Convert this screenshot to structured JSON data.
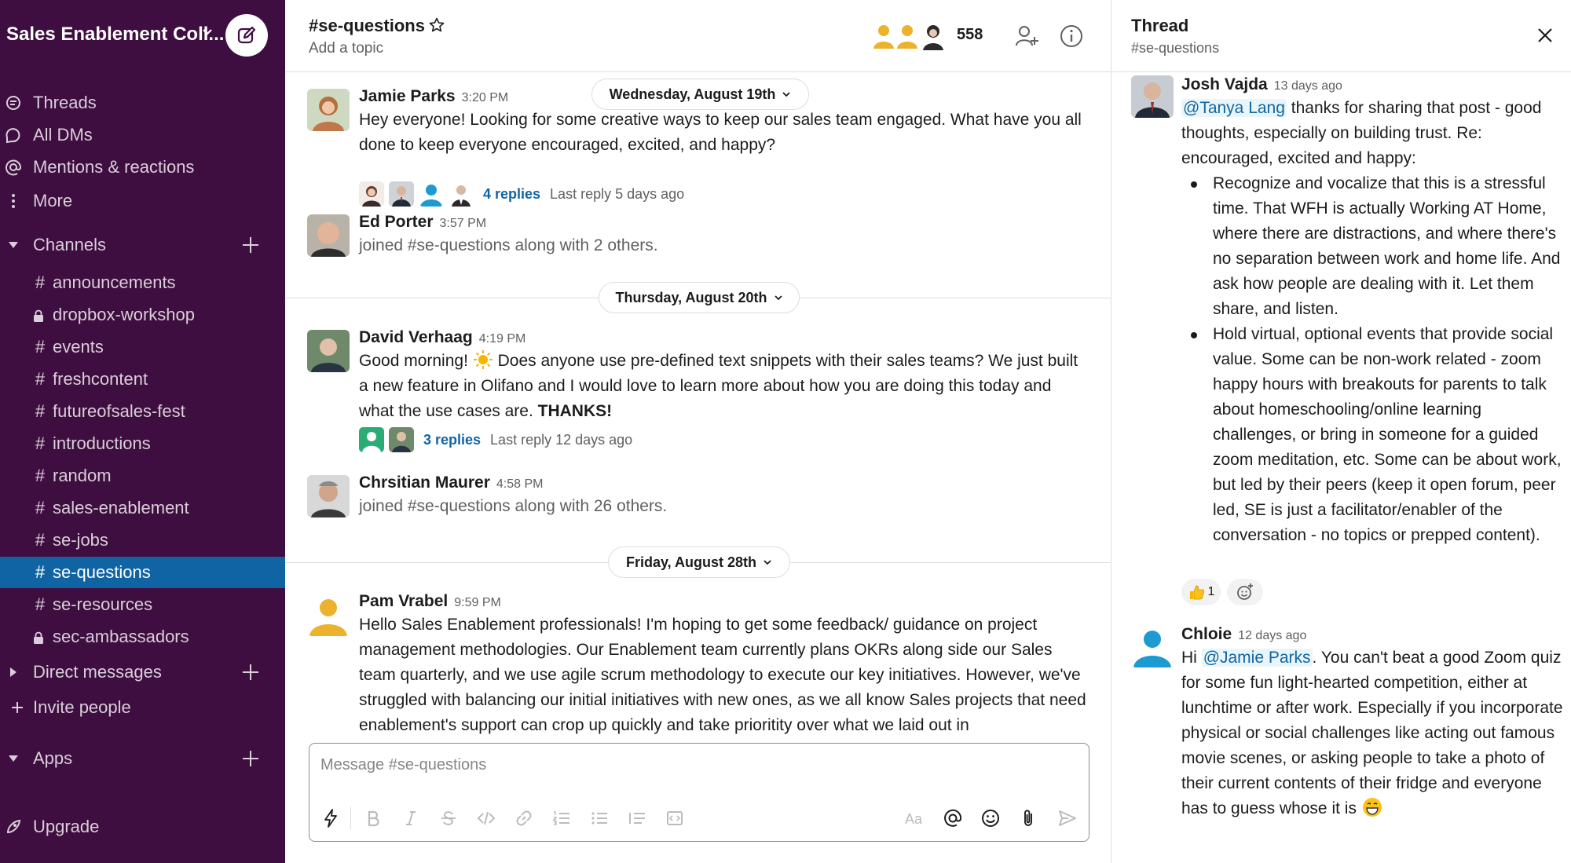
{
  "workspace": {
    "name": "Sales Enablement Coll..."
  },
  "nav": {
    "threads": "Threads",
    "all_dms": "All DMs",
    "mentions": "Mentions & reactions",
    "more": "More"
  },
  "channels": {
    "header": "Channels",
    "items": [
      {
        "name": "announcements",
        "private": false
      },
      {
        "name": "dropbox-workshop",
        "private": true
      },
      {
        "name": "events",
        "private": false
      },
      {
        "name": "freshcontent",
        "private": false
      },
      {
        "name": "futureofsales-fest",
        "private": false
      },
      {
        "name": "introductions",
        "private": false
      },
      {
        "name": "random",
        "private": false
      },
      {
        "name": "sales-enablement",
        "private": false
      },
      {
        "name": "se-jobs",
        "private": false
      },
      {
        "name": "se-questions",
        "private": false,
        "active": true
      },
      {
        "name": "se-resources",
        "private": false
      },
      {
        "name": "sec-ambassadors",
        "private": true
      }
    ],
    "hash_symbol": "#"
  },
  "direct_messages": {
    "header": "Direct messages"
  },
  "invite": {
    "label": "Invite people"
  },
  "apps": {
    "header": "Apps"
  },
  "upgrade": {
    "label": "Upgrade"
  },
  "channel": {
    "title": "#se-questions",
    "topic": "Add a topic",
    "member_count": "558"
  },
  "dates": {
    "d1": "Wednesday, August 19th",
    "d2": "Thursday, August 20th",
    "d3": "Friday, August 28th"
  },
  "messages": [
    {
      "author": "Jamie Parks",
      "time": "3:20 PM",
      "text": "Hey everyone! Looking for some creative ways to keep our sales team engaged. What have you all done to keep everyone encouraged, excited, and happy?",
      "replies": "4 replies",
      "last_reply": "Last reply 5 days ago"
    },
    {
      "author": "Ed Porter",
      "time": "3:57 PM",
      "text": "joined #se-questions along with 2 others."
    },
    {
      "author": "David Verhaag",
      "time": "4:19 PM",
      "text_a": "Good morning!",
      "text_b": "Does anyone use pre-defined text snippets with their sales teams? We just built a new feature in Olifano and I would love to learn more about how you are doing this today and what the use cases are.",
      "text_bold": "THANKS!",
      "replies": "3 replies",
      "last_reply": "Last reply 12 days ago"
    },
    {
      "author": "Chrsitian Maurer",
      "time": "4:58 PM",
      "text": "joined #se-questions along with 26 others."
    },
    {
      "author": "Pam Vrabel",
      "time": "9:59 PM",
      "text": "Hello Sales Enablement professionals! I'm hoping to get some feedback/ guidance on project management methodologies. Our Enablement team currently plans OKRs along side our Sales team quarterly, and we use agile scrum methodology to execute our key initiatives. However, we've struggled with balancing our initial initiatives with new ones, as we all know Sales projects that need enablement's support can crop up quickly and take prioritity over what we laid out in"
    }
  ],
  "composer": {
    "placeholder": "Message #se-questions"
  },
  "thread": {
    "title": "Thread",
    "channel": "#se-questions",
    "messages": [
      {
        "author": "Josh Vajda",
        "time": "13 days ago",
        "mention": "@Tanya Lang",
        "text": "thanks for sharing that post - good thoughts, especially on building trust. Re: encouraged, excited and happy:",
        "bullets": [
          "Recognize and vocalize that this is a stressful time. That WFH is actually Working AT Home, where there are distractions, and where there's no separation between work and home life. And ask how people are dealing with it. Let them share, and listen.",
          "Hold virtual, optional events that provide social value. Some can be non-work related - zoom happy hours with breakouts for parents to talk about homeschooling/online learning challenges, or bring in someone for a guided zoom meditation, etc. Some can be about work, but led by their peers (keep it open forum, peer led, SE is just a facilitator/enabler of the conversation - no topics or prepped content)."
        ],
        "reaction_count": "1"
      },
      {
        "author": "Chloie",
        "time": "12 days ago",
        "prefix": "Hi",
        "mention": "@Jamie Parks",
        "text": ". You can't beat a good Zoom quiz for some fun light-hearted competition, either at lunchtime or after work.  Especially if you incorporate physical or social challenges like acting out famous movie scenes, or asking people to take a photo of their current contents of their fridge and everyone has to guess whose it is"
      }
    ]
  },
  "colors": {
    "sidebar_bg": "#3f0e40",
    "active_channel": "#1164a3",
    "link": "#1264a3"
  }
}
